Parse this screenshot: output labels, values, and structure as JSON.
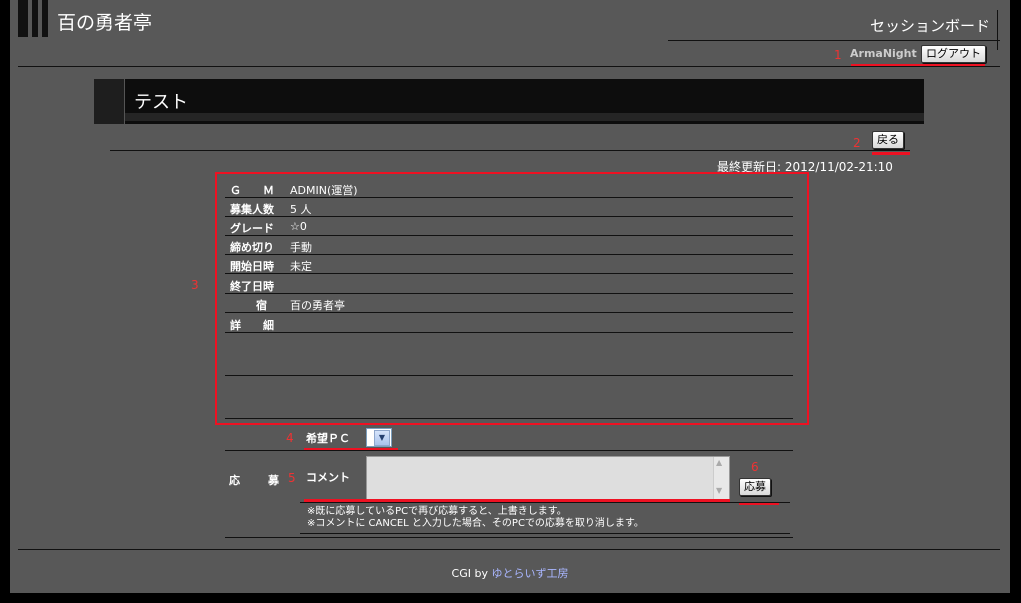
{
  "header": {
    "site_title": "百の勇者亭",
    "board_title": "セッションボード",
    "user_name": "ArmaNight",
    "logout_label": "ログアウト"
  },
  "session": {
    "title": "テスト",
    "back_label": "戻る",
    "updated": "最終更新日: 2012/11/02-21:10"
  },
  "details": [
    {
      "label": "Ｇ　　Ｍ",
      "value": "ADMIN(運営)"
    },
    {
      "label": "募集人数",
      "value": "5 人"
    },
    {
      "label": "グレード",
      "value": "☆0"
    },
    {
      "label": "締め切り",
      "value": "手動"
    },
    {
      "label": "開始日時",
      "value": "未定"
    },
    {
      "label": "終了日時",
      "value": ""
    },
    {
      "label": "　宿",
      "value": "百の勇者亭"
    },
    {
      "label": "詳　　細",
      "value": ""
    }
  ],
  "apply": {
    "label_a": "応",
    "label_b": "募",
    "pc_label": "希望ＰＣ",
    "pc_selected": "",
    "comment_label": "コメント",
    "comment_value": "",
    "apply_button": "応募",
    "note1": "※既に応募しているPCで再び応募すると、上書きします。",
    "note2": "※コメントに CANCEL と入力した場合、そのPCでの応募を取り消します。"
  },
  "footer": {
    "prefix": "CGI by ",
    "link": "ゆとらいず工房"
  },
  "annotations": [
    "1",
    "2",
    "3",
    "4",
    "5",
    "6"
  ],
  "colors": {
    "background": "#585858",
    "highlight": "#e12222",
    "link": "#a9b6ff"
  }
}
